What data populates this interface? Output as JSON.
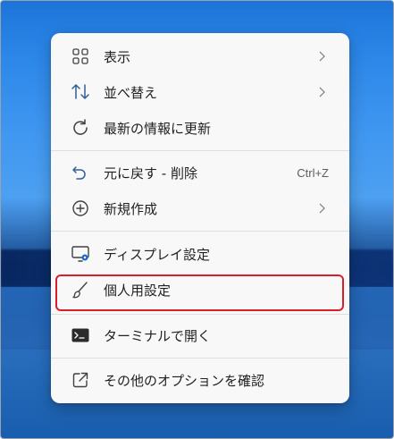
{
  "context_menu": {
    "items": [
      {
        "label": "表示",
        "icon": "grid-view-icon",
        "submenu": true
      },
      {
        "label": "並べ替え",
        "icon": "sort-arrows-icon",
        "submenu": true
      },
      {
        "label": "最新の情報に更新",
        "icon": "refresh-icon",
        "submenu": false
      },
      {
        "label": "元に戻す - 削除",
        "icon": "undo-icon",
        "shortcut": "Ctrl+Z"
      },
      {
        "label": "新規作成",
        "icon": "new-plus-circle-icon",
        "submenu": true
      },
      {
        "label": "ディスプレイ設定",
        "icon": "display-settings-icon",
        "submenu": false
      },
      {
        "label": "個人用設定",
        "icon": "paintbrush-icon",
        "submenu": false,
        "highlighted": true
      },
      {
        "label": "ターミナルで開く",
        "icon": "terminal-icon",
        "submenu": false
      },
      {
        "label": "その他のオプションを確認",
        "icon": "open-external-icon",
        "submenu": false
      }
    ]
  },
  "colors": {
    "menu_background": "#f8f8f8",
    "highlight_border": "#d61f2b",
    "accent": "#0067c0",
    "text": "#1f1f1f",
    "desktop_blue": "#2b86e8"
  }
}
